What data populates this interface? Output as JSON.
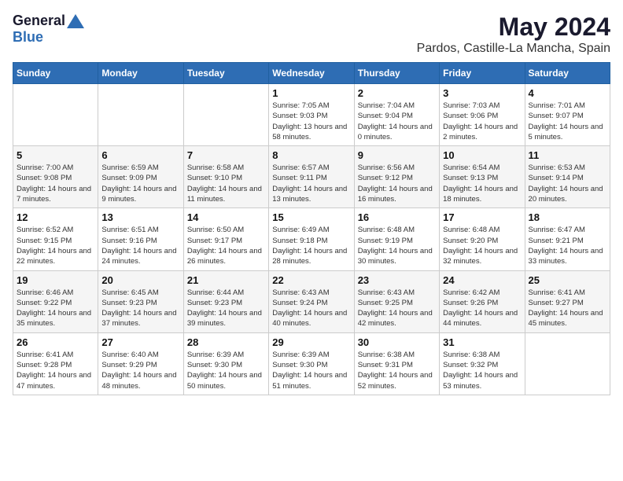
{
  "header": {
    "logo_general": "General",
    "logo_blue": "Blue",
    "month_title": "May 2024",
    "location": "Pardos, Castille-La Mancha, Spain"
  },
  "calendar": {
    "headers": [
      "Sunday",
      "Monday",
      "Tuesday",
      "Wednesday",
      "Thursday",
      "Friday",
      "Saturday"
    ],
    "weeks": [
      [
        {
          "day": "",
          "sunrise": "",
          "sunset": "",
          "daylight": ""
        },
        {
          "day": "",
          "sunrise": "",
          "sunset": "",
          "daylight": ""
        },
        {
          "day": "",
          "sunrise": "",
          "sunset": "",
          "daylight": ""
        },
        {
          "day": "1",
          "sunrise": "Sunrise: 7:05 AM",
          "sunset": "Sunset: 9:03 PM",
          "daylight": "Daylight: 13 hours and 58 minutes."
        },
        {
          "day": "2",
          "sunrise": "Sunrise: 7:04 AM",
          "sunset": "Sunset: 9:04 PM",
          "daylight": "Daylight: 14 hours and 0 minutes."
        },
        {
          "day": "3",
          "sunrise": "Sunrise: 7:03 AM",
          "sunset": "Sunset: 9:06 PM",
          "daylight": "Daylight: 14 hours and 2 minutes."
        },
        {
          "day": "4",
          "sunrise": "Sunrise: 7:01 AM",
          "sunset": "Sunset: 9:07 PM",
          "daylight": "Daylight: 14 hours and 5 minutes."
        }
      ],
      [
        {
          "day": "5",
          "sunrise": "Sunrise: 7:00 AM",
          "sunset": "Sunset: 9:08 PM",
          "daylight": "Daylight: 14 hours and 7 minutes."
        },
        {
          "day": "6",
          "sunrise": "Sunrise: 6:59 AM",
          "sunset": "Sunset: 9:09 PM",
          "daylight": "Daylight: 14 hours and 9 minutes."
        },
        {
          "day": "7",
          "sunrise": "Sunrise: 6:58 AM",
          "sunset": "Sunset: 9:10 PM",
          "daylight": "Daylight: 14 hours and 11 minutes."
        },
        {
          "day": "8",
          "sunrise": "Sunrise: 6:57 AM",
          "sunset": "Sunset: 9:11 PM",
          "daylight": "Daylight: 14 hours and 13 minutes."
        },
        {
          "day": "9",
          "sunrise": "Sunrise: 6:56 AM",
          "sunset": "Sunset: 9:12 PM",
          "daylight": "Daylight: 14 hours and 16 minutes."
        },
        {
          "day": "10",
          "sunrise": "Sunrise: 6:54 AM",
          "sunset": "Sunset: 9:13 PM",
          "daylight": "Daylight: 14 hours and 18 minutes."
        },
        {
          "day": "11",
          "sunrise": "Sunrise: 6:53 AM",
          "sunset": "Sunset: 9:14 PM",
          "daylight": "Daylight: 14 hours and 20 minutes."
        }
      ],
      [
        {
          "day": "12",
          "sunrise": "Sunrise: 6:52 AM",
          "sunset": "Sunset: 9:15 PM",
          "daylight": "Daylight: 14 hours and 22 minutes."
        },
        {
          "day": "13",
          "sunrise": "Sunrise: 6:51 AM",
          "sunset": "Sunset: 9:16 PM",
          "daylight": "Daylight: 14 hours and 24 minutes."
        },
        {
          "day": "14",
          "sunrise": "Sunrise: 6:50 AM",
          "sunset": "Sunset: 9:17 PM",
          "daylight": "Daylight: 14 hours and 26 minutes."
        },
        {
          "day": "15",
          "sunrise": "Sunrise: 6:49 AM",
          "sunset": "Sunset: 9:18 PM",
          "daylight": "Daylight: 14 hours and 28 minutes."
        },
        {
          "day": "16",
          "sunrise": "Sunrise: 6:48 AM",
          "sunset": "Sunset: 9:19 PM",
          "daylight": "Daylight: 14 hours and 30 minutes."
        },
        {
          "day": "17",
          "sunrise": "Sunrise: 6:48 AM",
          "sunset": "Sunset: 9:20 PM",
          "daylight": "Daylight: 14 hours and 32 minutes."
        },
        {
          "day": "18",
          "sunrise": "Sunrise: 6:47 AM",
          "sunset": "Sunset: 9:21 PM",
          "daylight": "Daylight: 14 hours and 33 minutes."
        }
      ],
      [
        {
          "day": "19",
          "sunrise": "Sunrise: 6:46 AM",
          "sunset": "Sunset: 9:22 PM",
          "daylight": "Daylight: 14 hours and 35 minutes."
        },
        {
          "day": "20",
          "sunrise": "Sunrise: 6:45 AM",
          "sunset": "Sunset: 9:23 PM",
          "daylight": "Daylight: 14 hours and 37 minutes."
        },
        {
          "day": "21",
          "sunrise": "Sunrise: 6:44 AM",
          "sunset": "Sunset: 9:23 PM",
          "daylight": "Daylight: 14 hours and 39 minutes."
        },
        {
          "day": "22",
          "sunrise": "Sunrise: 6:43 AM",
          "sunset": "Sunset: 9:24 PM",
          "daylight": "Daylight: 14 hours and 40 minutes."
        },
        {
          "day": "23",
          "sunrise": "Sunrise: 6:43 AM",
          "sunset": "Sunset: 9:25 PM",
          "daylight": "Daylight: 14 hours and 42 minutes."
        },
        {
          "day": "24",
          "sunrise": "Sunrise: 6:42 AM",
          "sunset": "Sunset: 9:26 PM",
          "daylight": "Daylight: 14 hours and 44 minutes."
        },
        {
          "day": "25",
          "sunrise": "Sunrise: 6:41 AM",
          "sunset": "Sunset: 9:27 PM",
          "daylight": "Daylight: 14 hours and 45 minutes."
        }
      ],
      [
        {
          "day": "26",
          "sunrise": "Sunrise: 6:41 AM",
          "sunset": "Sunset: 9:28 PM",
          "daylight": "Daylight: 14 hours and 47 minutes."
        },
        {
          "day": "27",
          "sunrise": "Sunrise: 6:40 AM",
          "sunset": "Sunset: 9:29 PM",
          "daylight": "Daylight: 14 hours and 48 minutes."
        },
        {
          "day": "28",
          "sunrise": "Sunrise: 6:39 AM",
          "sunset": "Sunset: 9:30 PM",
          "daylight": "Daylight: 14 hours and 50 minutes."
        },
        {
          "day": "29",
          "sunrise": "Sunrise: 6:39 AM",
          "sunset": "Sunset: 9:30 PM",
          "daylight": "Daylight: 14 hours and 51 minutes."
        },
        {
          "day": "30",
          "sunrise": "Sunrise: 6:38 AM",
          "sunset": "Sunset: 9:31 PM",
          "daylight": "Daylight: 14 hours and 52 minutes."
        },
        {
          "day": "31",
          "sunrise": "Sunrise: 6:38 AM",
          "sunset": "Sunset: 9:32 PM",
          "daylight": "Daylight: 14 hours and 53 minutes."
        },
        {
          "day": "",
          "sunrise": "",
          "sunset": "",
          "daylight": ""
        }
      ]
    ]
  }
}
